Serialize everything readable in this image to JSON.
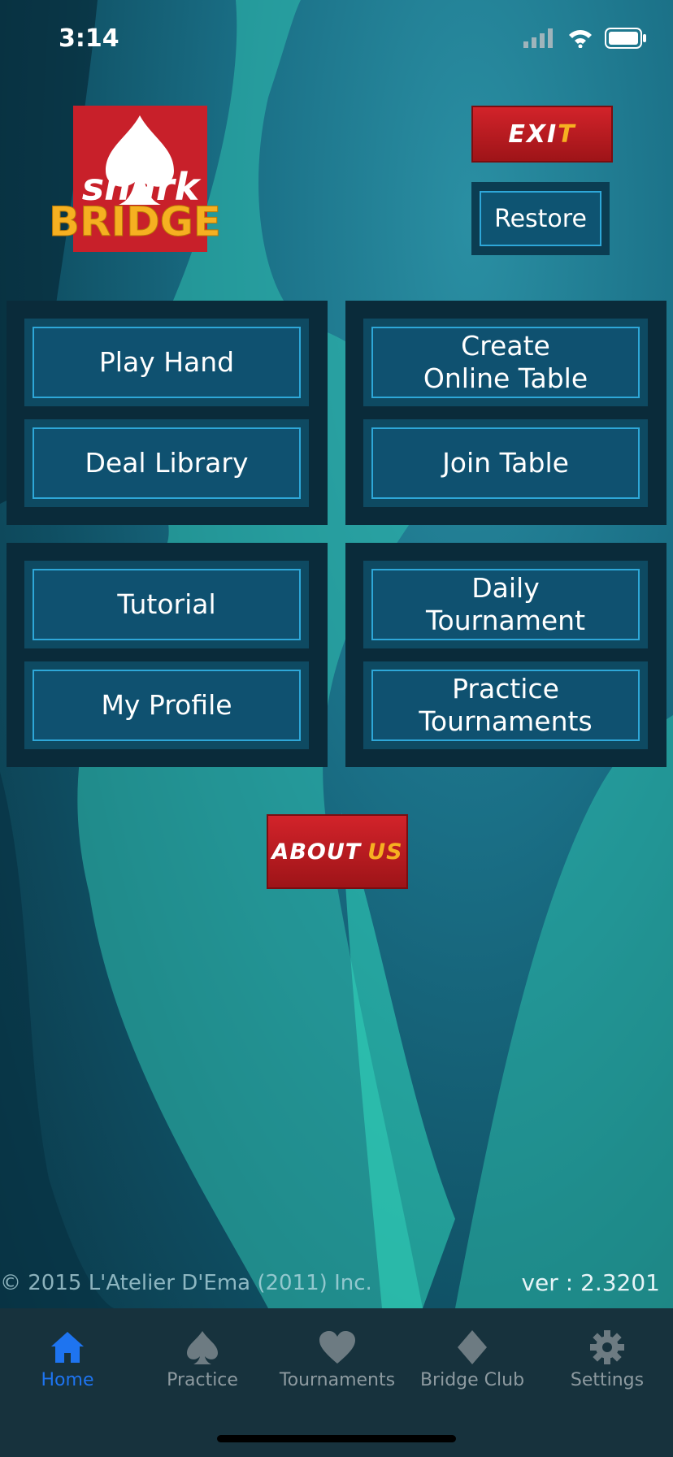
{
  "status_bar": {
    "time": "3:14"
  },
  "logo": {
    "top_word": "shark",
    "bottom_word": "BRIDGE",
    "suit": "spade"
  },
  "header": {
    "exit_part1": "EXI",
    "exit_part2": "T",
    "restore_label": "Restore"
  },
  "menu": {
    "group1": {
      "top": "Play Hand",
      "bottom": "Deal Library"
    },
    "group2": {
      "top": "Create\nOnline Table",
      "bottom": "Join Table"
    },
    "group3": {
      "top": "Tutorial",
      "bottom": "My Profile"
    },
    "group4": {
      "top": "Daily\nTournament",
      "bottom": "Practice\nTournaments"
    }
  },
  "about": {
    "part1": "ABOUT",
    "part2": "US"
  },
  "footer": {
    "copyright": "© 2015 L'Atelier D'Ema (2011) Inc.",
    "version": "ver : 2.3201"
  },
  "tabs": [
    {
      "label": "Home",
      "icon": "home-icon",
      "active": true
    },
    {
      "label": "Practice",
      "icon": "spade-icon",
      "active": false
    },
    {
      "label": "Tournaments",
      "icon": "heart-icon",
      "active": false
    },
    {
      "label": "Bridge Club",
      "icon": "diamond-icon",
      "active": false
    },
    {
      "label": "Settings",
      "icon": "gear-icon",
      "active": false
    }
  ],
  "colors": {
    "accent_active_tab": "#1e74f0",
    "button_border": "#2ea7d8",
    "red_button": "#d2232a",
    "logo_yellow": "#f6b021"
  }
}
